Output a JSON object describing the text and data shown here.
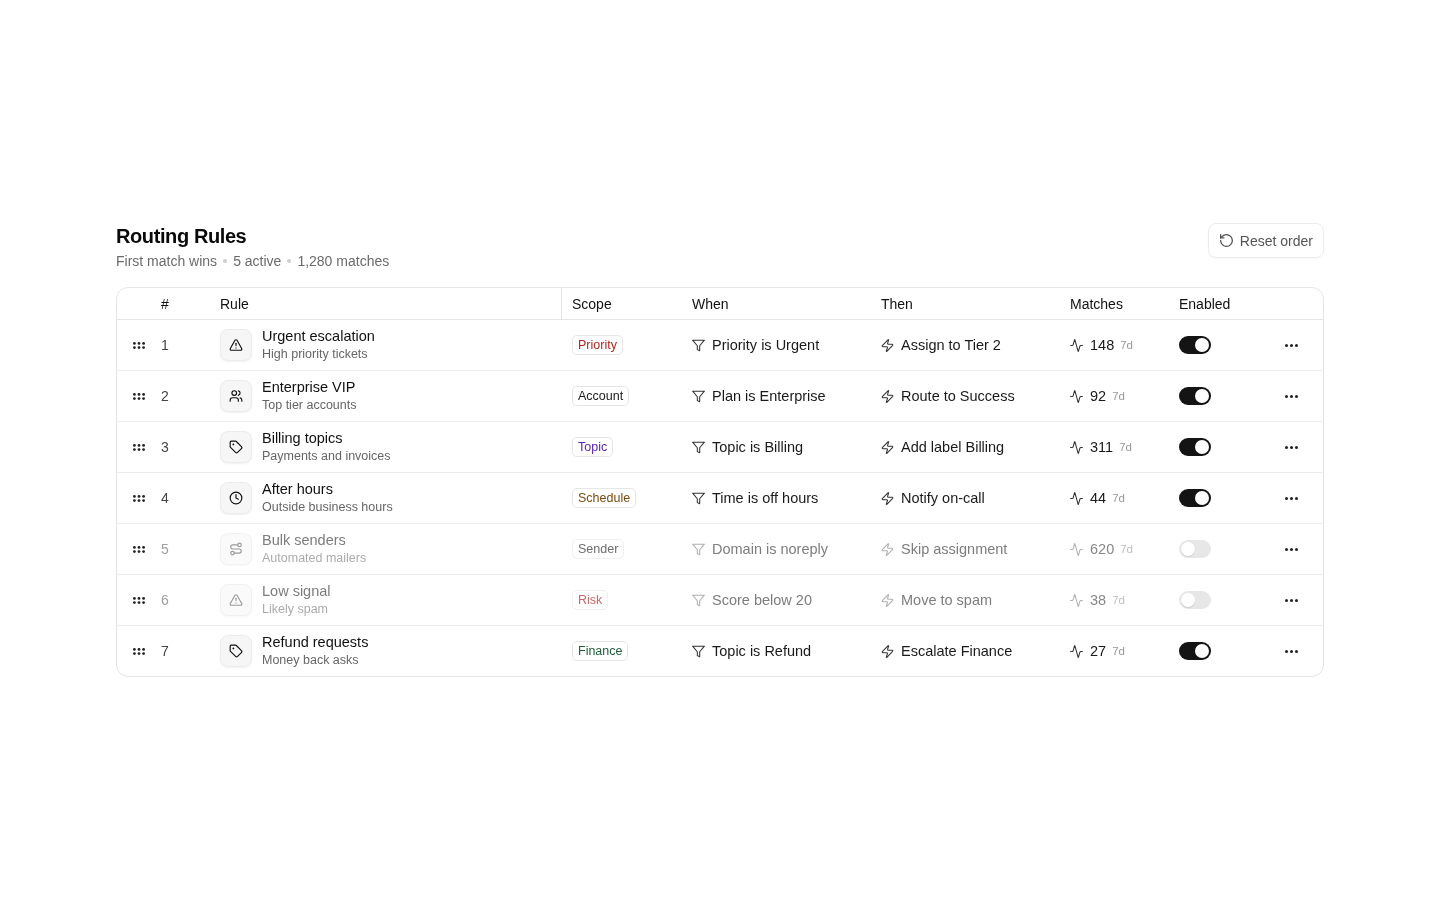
{
  "header": {
    "title": "Routing Rules",
    "summary": [
      "First match wins",
      "5 active",
      "1,280 matches"
    ],
    "reset_button": "Reset order"
  },
  "table": {
    "columns": [
      "#",
      "Rule",
      "Scope",
      "When",
      "Then",
      "Matches",
      "Enabled"
    ],
    "rows": [
      {
        "number": "1",
        "kind": "alert",
        "title": "Urgent escalation",
        "description": "High priority tickets",
        "scope": {
          "label": "Priority",
          "color": "#b3261e"
        },
        "when": "Priority is Urgent",
        "then": "Assign to Tier 2",
        "matches": {
          "count": "148",
          "period": "7d"
        },
        "enabled": true
      },
      {
        "number": "2",
        "kind": "people",
        "title": "Enterprise VIP",
        "description": "Top tier accounts",
        "scope": {
          "label": "Account",
          "color": "#1a1a1a"
        },
        "when": "Plan is Enterprise",
        "then": "Route to Success",
        "matches": {
          "count": "92",
          "period": "7d"
        },
        "enabled": true
      },
      {
        "number": "3",
        "kind": "tag",
        "title": "Billing topics",
        "description": "Payments and invoices",
        "scope": {
          "label": "Topic",
          "color": "#5b21b6"
        },
        "when": "Topic is Billing",
        "then": "Add label Billing",
        "matches": {
          "count": "311",
          "period": "7d"
        },
        "enabled": true
      },
      {
        "number": "4",
        "kind": "clock",
        "title": "After hours",
        "description": "Outside business hours",
        "scope": {
          "label": "Schedule",
          "color": "#7c4a0f"
        },
        "when": "Time is off hours",
        "then": "Notify on-call",
        "matches": {
          "count": "44",
          "period": "7d"
        },
        "enabled": true
      },
      {
        "number": "5",
        "kind": "route",
        "title": "Bulk senders",
        "description": "Automated mailers",
        "scope": {
          "label": "Sender",
          "color": "#6e6e6e"
        },
        "when": "Domain is noreply",
        "then": "Skip assignment",
        "matches": {
          "count": "620",
          "period": "7d"
        },
        "enabled": false
      },
      {
        "number": "6",
        "kind": "alert",
        "title": "Low signal",
        "description": "Likely spam",
        "scope": {
          "label": "Risk",
          "color": "#c76868"
        },
        "when": "Score below 20",
        "then": "Move to spam",
        "matches": {
          "count": "38",
          "period": "7d"
        },
        "enabled": false
      },
      {
        "number": "7",
        "kind": "tag",
        "title": "Refund requests",
        "description": "Money back asks",
        "scope": {
          "label": "Finance",
          "color": "#1e5e3a"
        },
        "when": "Topic is Refund",
        "then": "Escalate Finance",
        "matches": {
          "count": "27",
          "period": "7d"
        },
        "enabled": true
      }
    ]
  }
}
